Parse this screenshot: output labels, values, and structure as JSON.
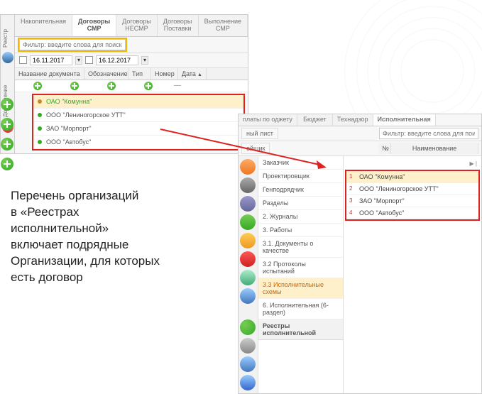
{
  "panel1": {
    "tabs": [
      "Накопительная",
      "Договоры СМР",
      "Договоры НЕСМР",
      "Договоры Поставки",
      "Выполнение СМР"
    ],
    "active_tab": 1,
    "filter_placeholder": "Фильтр: введите слова для поиска",
    "date_from": "16.11.2017",
    "date_to": "16.12.2017",
    "columns": [
      "Название документа",
      "Обозначение",
      "Тип",
      "Номер",
      "Дата"
    ],
    "side_labels": {
      "reestr": "Реестр",
      "dobavlenie": "Добавление"
    },
    "orgs": [
      "ОАО \"Комунна\"",
      "ООО \"Лениногорское УТТ\"",
      "ЗАО \"Морпорт\"",
      "ООО \"Автобус\""
    ]
  },
  "panel2": {
    "tabs_top": [
      "платы по оджету",
      "Бюджет",
      "Технадзор",
      "Исполнительная"
    ],
    "active_tab": 3,
    "sheet_label": "ный лист",
    "obschik_label": "ойщик",
    "filter_placeholder": "Фильтр: введите слова для поиска",
    "tree": [
      "Заказчик",
      "Проектировщик",
      "Генподрядчик",
      "Разделы",
      "2. Журналы",
      "3. Работы",
      "3.1. Документы о качестве",
      "3.2 Протоколы испытаний",
      "3.3 Исполнительные схемы",
      "6. Исполнительная (6-раздел)"
    ],
    "tree_selected": 8,
    "reestry_header": "Реестры исполнительной",
    "table_headers": {
      "no": "№",
      "name": "Наименование"
    },
    "orgs": [
      {
        "n": "1",
        "name": "ОАО \"Комунна\""
      },
      {
        "n": "2",
        "name": "ООО \"Лениногорское УТТ\""
      },
      {
        "n": "3",
        "name": "ЗАО \"Морпорт\""
      },
      {
        "n": "4",
        "name": "ООО \"Автобус\""
      }
    ]
  },
  "caption": {
    "l1": "Перечень организаций",
    "l2": "в «Реестрах",
    "l3": "исполнительной»",
    "l4": "включает подрядные",
    "l5": "Организации, для которых",
    "l6": "есть договор"
  }
}
